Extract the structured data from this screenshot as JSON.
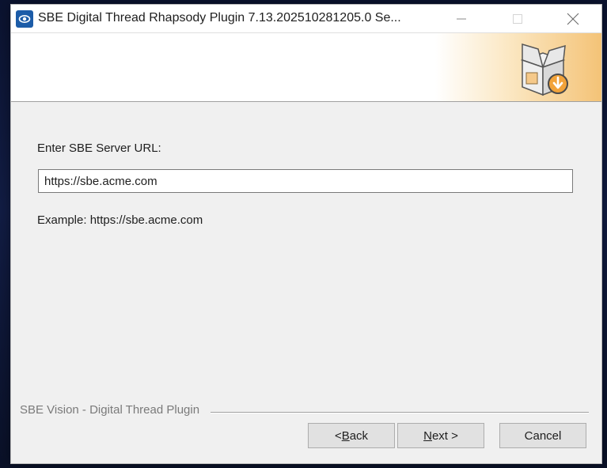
{
  "window": {
    "title": "SBE Digital Thread Rhapsody Plugin 7.13.202510281205.0 Se...",
    "controls": {
      "minimize": "minimize-icon",
      "maximize": "maximize-icon",
      "close": "close-icon"
    }
  },
  "header": {
    "image": "installer-box-icon",
    "accent_color": "#f4c377"
  },
  "form": {
    "url_label": "Enter SBE Server URL:",
    "url_value": "https://sbe.acme.com",
    "example_text": "Example: https://sbe.acme.com"
  },
  "footer": {
    "group_label": "SBE Vision - Digital Thread Plugin",
    "back_prefix": "< ",
    "back_mnemonic": "B",
    "back_rest": "ack",
    "next_mnemonic": "N",
    "next_rest": "ext >",
    "cancel_label": "Cancel"
  }
}
